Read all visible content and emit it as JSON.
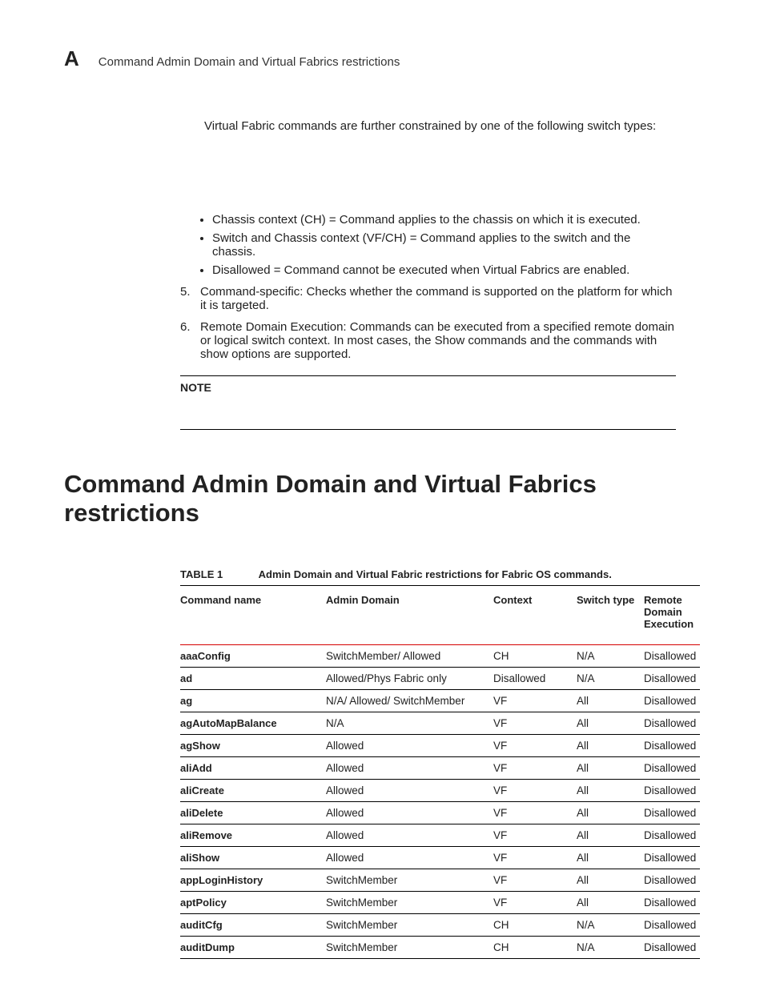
{
  "header": {
    "letter": "A",
    "subtitle": "Command Admin Domain and Virtual Fabrics restrictions"
  },
  "intro": "Virtual Fabric commands are further constrained by one of the following switch types:",
  "bullets": [
    "Chassis context (CH) = Command applies to the chassis on which it is executed.",
    "Switch and Chassis context (VF/CH) = Command applies to the switch and the chassis.",
    "Disallowed = Command cannot be executed when Virtual Fabrics are enabled."
  ],
  "ordered": [
    {
      "n": "5.",
      "text": "Command-specific: Checks whether the command is supported on the platform for which it is targeted."
    },
    {
      "n": "6.",
      "text": "Remote Domain Execution: Commands can be executed from a specified remote domain or logical switch context. In most cases, the Show commands and the commands with show options are supported."
    }
  ],
  "note_label": "NOTE",
  "section_heading": "Command Admin Domain and Virtual Fabrics restrictions",
  "table": {
    "label": "TABLE 1",
    "title": "Admin Domain and Virtual Fabric restrictions for Fabric OS commands.",
    "headers": {
      "cmd": "Command name",
      "ad": "Admin Domain",
      "ctx": "Context",
      "sw": "Switch type",
      "rem": "Remote Domain Execution"
    },
    "rows": [
      {
        "cmd": "aaaConfig",
        "ad": "SwitchMember/ Allowed",
        "ctx": "CH",
        "sw": "N/A",
        "rem": "Disallowed"
      },
      {
        "cmd": "ad",
        "ad": "Allowed/Phys Fabric only",
        "ctx": "Disallowed",
        "sw": "N/A",
        "rem": "Disallowed"
      },
      {
        "cmd": "ag",
        "ad": "N/A/ Allowed/ SwitchMember",
        "ctx": "VF",
        "sw": "All",
        "rem": "Disallowed"
      },
      {
        "cmd": "agAutoMapBalance",
        "ad": "N/A",
        "ctx": "VF",
        "sw": "All",
        "rem": "Disallowed"
      },
      {
        "cmd": "agShow",
        "ad": "Allowed",
        "ctx": "VF",
        "sw": "All",
        "rem": "Disallowed"
      },
      {
        "cmd": "aliAdd",
        "ad": "Allowed",
        "ctx": "VF",
        "sw": "All",
        "rem": "Disallowed"
      },
      {
        "cmd": "aliCreate",
        "ad": "Allowed",
        "ctx": "VF",
        "sw": "All",
        "rem": "Disallowed"
      },
      {
        "cmd": "aliDelete",
        "ad": "Allowed",
        "ctx": "VF",
        "sw": "All",
        "rem": "Disallowed"
      },
      {
        "cmd": "aliRemove",
        "ad": "Allowed",
        "ctx": "VF",
        "sw": "All",
        "rem": "Disallowed"
      },
      {
        "cmd": "aliShow",
        "ad": "Allowed",
        "ctx": "VF",
        "sw": "All",
        "rem": "Disallowed"
      },
      {
        "cmd": "appLoginHistory",
        "ad": "SwitchMember",
        "ctx": "VF",
        "sw": "All",
        "rem": "Disallowed"
      },
      {
        "cmd": "aptPolicy",
        "ad": "SwitchMember",
        "ctx": "VF",
        "sw": "All",
        "rem": "Disallowed"
      },
      {
        "cmd": "auditCfg",
        "ad": "SwitchMember",
        "ctx": "CH",
        "sw": "N/A",
        "rem": "Disallowed"
      },
      {
        "cmd": "auditDump",
        "ad": "SwitchMember",
        "ctx": "CH",
        "sw": "N/A",
        "rem": "Disallowed"
      }
    ]
  }
}
